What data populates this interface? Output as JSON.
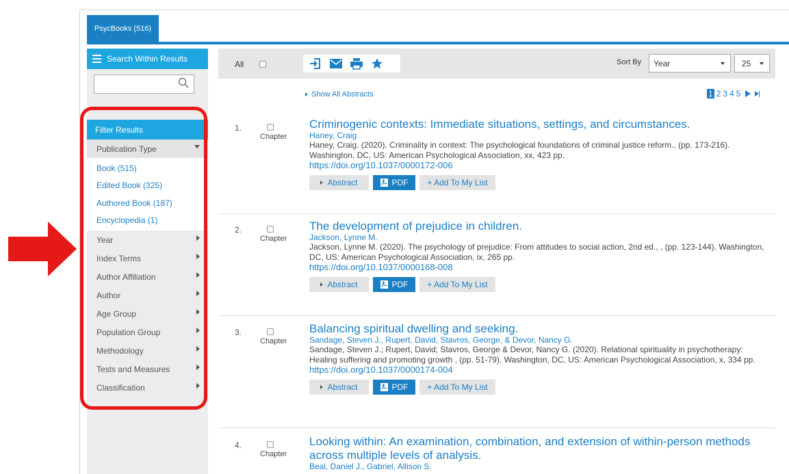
{
  "tab": {
    "label": "PsycBooks (516)"
  },
  "sidebar": {
    "search_header": "Search Within Results",
    "search_value": "",
    "filter_header": "Filter Results",
    "publication_type": {
      "label": "Publication Type",
      "items": [
        "Book (515)",
        "Edited Book (325)",
        "Authored Book (187)",
        "Encyclopedia (1)"
      ]
    },
    "facets": [
      "Year",
      "Index Terms",
      "Author Affiliation",
      "Author",
      "Age Group",
      "Population Group",
      "Methodology",
      "Tests and Measures",
      "Classification"
    ]
  },
  "toolbar": {
    "all_label": "All",
    "icons": [
      "export-icon",
      "email-icon",
      "print-icon",
      "star-icon"
    ],
    "sort_label": "Sort By",
    "sort_value": "Year",
    "per_page": "25"
  },
  "results_header": {
    "show_abstracts": "Show All Abstracts",
    "pages": [
      "1",
      "2",
      "3",
      "4",
      "5"
    ],
    "current_page": "1"
  },
  "results": [
    {
      "num": "1.",
      "type": "Chapter",
      "title": "Criminogenic contexts: Immediate situations, settings, and circumstances.",
      "authors": "Haney, Craig",
      "citation": "Haney, Craig. (2020). Criminality in context: The psychological foundations of criminal justice reform., (pp. 173-216). Washington, DC, US: American Psychological Association, xx, 423 pp.",
      "doi": "https://doi.org/10.1037/0000172-006"
    },
    {
      "num": "2.",
      "type": "Chapter",
      "title": "The development of prejudice in children.",
      "authors": "Jackson, Lynne M.",
      "citation": "Jackson, Lynne M. (2020). The psychology of prejudice: From attitudes to social action, 2nd ed., , (pp. 123-144). Washington, DC, US: American Psychological Association, ix, 265 pp.",
      "doi": "https://doi.org/10.1037/0000168-008"
    },
    {
      "num": "3.",
      "type": "Chapter",
      "title": "Balancing spiritual dwelling and seeking.",
      "authors": "Sandage, Steven J., Rupert, David, Stavros, George, & Devor, Nancy G.",
      "citation": "Sandage, Steven J.; Rupert, David; Stavros, George & Devor, Nancy G. (2020). Relational spirituality in psychotherapy: Healing suffering and promoting growth , (pp. 51-79). Washington, DC, US: American Psychological Association, x, 334 pp.",
      "doi": "https://doi.org/10.1037/0000174-004"
    },
    {
      "num": "4.",
      "type": "Chapter",
      "title": "Looking within: An examination, combination, and extension of within-person methods across multiple levels of analysis.",
      "authors": "Beal, Daniel J., Gabriel, Allison S."
    }
  ],
  "actions": {
    "abstract": "Abstract",
    "pdf": "PDF",
    "add": "+ Add To My List"
  },
  "colors": {
    "accent": "#1b7fc4",
    "header_blue": "#1ea6e0",
    "highlight": "#e61919"
  }
}
